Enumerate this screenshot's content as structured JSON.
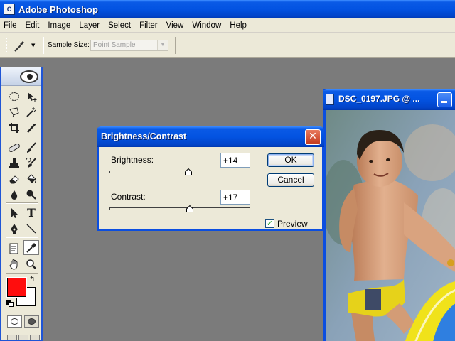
{
  "app": {
    "title": "Adobe Photoshop",
    "icon": "photoshop-app-icon"
  },
  "menu": [
    "File",
    "Edit",
    "Image",
    "Layer",
    "Select",
    "Filter",
    "View",
    "Window",
    "Help"
  ],
  "options_bar": {
    "tool_icon": "eyedropper-icon",
    "sample_size_label": "Sample Size:",
    "sample_size_value": "Point Sample"
  },
  "toolbox": {
    "tools": [
      [
        "marquee-ellipse-icon",
        "move-icon"
      ],
      [
        "lasso-icon",
        "magic-wand-icon"
      ],
      [
        "crop-icon",
        "slice-icon"
      ],
      [
        "healing-brush-icon",
        "brush-icon"
      ],
      [
        "clone-stamp-icon",
        "history-brush-icon"
      ],
      [
        "eraser-icon",
        "paint-bucket-icon"
      ],
      [
        "blur-icon",
        "dodge-icon"
      ],
      [
        "path-selection-icon",
        "type-icon"
      ],
      [
        "pen-icon",
        "line-icon"
      ],
      [
        "notes-icon",
        "eyedropper-icon"
      ],
      [
        "hand-icon",
        "zoom-icon"
      ]
    ],
    "active_tool": "eyedropper-icon",
    "foreground_color": "#ff0d0d",
    "background_color": "#ffffff"
  },
  "document": {
    "title": "DSC_0197.JPG @ ..."
  },
  "dialog": {
    "title": "Brightness/Contrast",
    "brightness_label": "Brightness:",
    "brightness_value": "+14",
    "brightness_level": 14,
    "contrast_label": "Contrast:",
    "contrast_value": "+17",
    "contrast_level": 17,
    "ok_label": "OK",
    "cancel_label": "Cancel",
    "preview_label": "Preview",
    "preview_checked": true
  },
  "colors": {
    "titlebar_blue": "#0353e1",
    "dialog_face": "#ece9d8",
    "workspace": "#7b7b7b"
  }
}
